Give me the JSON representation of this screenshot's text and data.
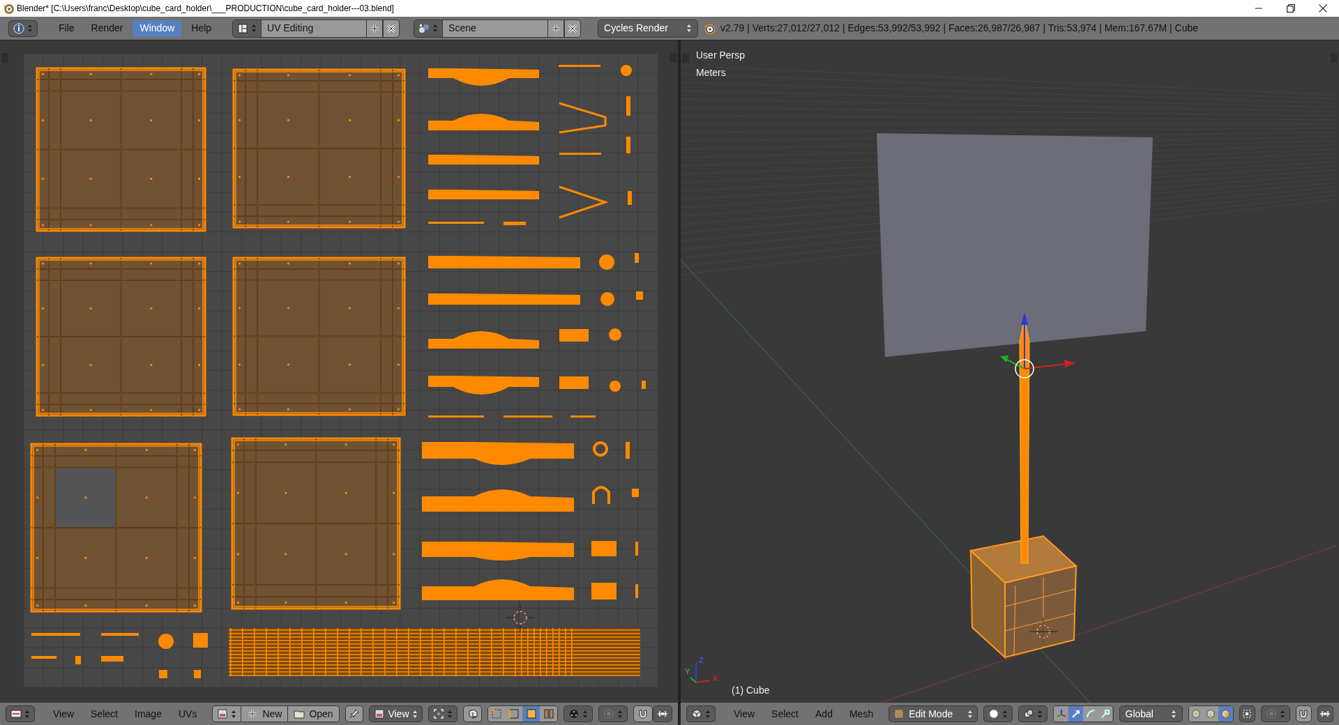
{
  "window": {
    "title": "Blender* [C:\\Users\\franc\\Desktop\\cube_card_holder\\___PRODUCTION\\cube_card_holder---03.blend]"
  },
  "top_bar": {
    "menus": [
      {
        "label": "File",
        "selected": false
      },
      {
        "label": "Render",
        "selected": false
      },
      {
        "label": "Window",
        "selected": true
      },
      {
        "label": "Help",
        "selected": false
      }
    ],
    "screen_layout": "UV Editing",
    "scene": "Scene",
    "render_engine": "Cycles Render",
    "stats": "v2.79 | Verts:27,012/27,012 | Edges:53,992/53,992 | Faces:26,987/26,987 | Tris:53,974 | Mem:167.67M | Cube"
  },
  "uv_editor": {
    "header": {
      "menus": [
        "View",
        "Select",
        "Image",
        "UVs"
      ],
      "new_button": "New",
      "open_button": "Open",
      "view_dropdown": "View",
      "selection_modes": [
        {
          "selected": false
        },
        {
          "selected": false
        },
        {
          "selected": true
        },
        {
          "selected": false
        }
      ]
    }
  },
  "viewport": {
    "view_label": "User Persp",
    "units_label": "Meters",
    "object_label": "(1) Cube",
    "axes": [
      "X",
      "Y",
      "Z"
    ],
    "header": {
      "menus": [
        "View",
        "Select",
        "Add",
        "Mesh"
      ],
      "mode": "Edit Mode",
      "orientation": "Global",
      "manipulators": [
        {
          "selected": false
        },
        {
          "selected": true
        },
        {
          "selected": false
        },
        {
          "selected": false
        }
      ],
      "mesh_select_modes": [
        {
          "selected": false
        },
        {
          "selected": false
        },
        {
          "selected": true
        }
      ]
    }
  }
}
